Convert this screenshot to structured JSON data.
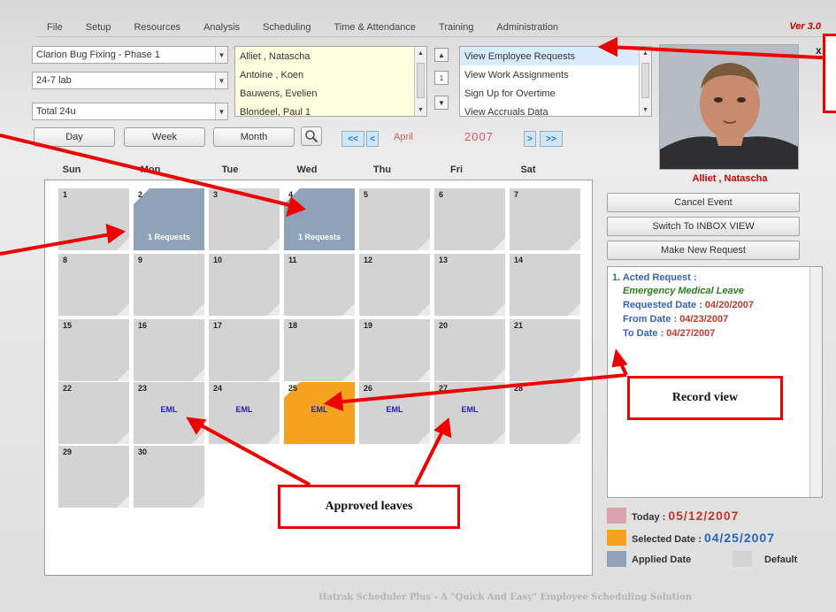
{
  "menu": {
    "items": [
      "File",
      "Setup",
      "Resources",
      "Analysis",
      "Scheduling",
      "Time & Attendance",
      "Training",
      "Administration"
    ],
    "version": "Ver 3.0"
  },
  "filters": {
    "project": "Clarion Bug Fixing - Phase 1",
    "lab": "24-7 lab",
    "group": "Total 24u"
  },
  "employees": [
    "Alliet , Natascha",
    "Antoine , Koen",
    "Bauwens, Evelien",
    "Blondeel, Paul 1"
  ],
  "stepper_value": "1",
  "actions": [
    "View Employee Requests",
    "View Work Assignments",
    "Sign Up for Overtime",
    "View Accruals Data"
  ],
  "view_buttons": {
    "day": "Day",
    "week": "Week",
    "month": "Month"
  },
  "nav": {
    "first": "<<",
    "prev": "<",
    "next": ">",
    "last": ">>"
  },
  "period": {
    "month": "April",
    "year": "2007"
  },
  "employee_name": "Alliet , Natascha",
  "close_label": "x",
  "weekdays": [
    "Sun",
    "Mon",
    "Tue",
    "Wed",
    "Thu",
    "Fri",
    "Sat"
  ],
  "calendar": {
    "weeks": [
      [
        {
          "d": "1"
        },
        {
          "d": "2",
          "type": "applied",
          "label": "1 Requests"
        },
        {
          "d": "3"
        },
        {
          "d": "4",
          "type": "applied",
          "label": "1 Requests"
        },
        {
          "d": "5"
        },
        {
          "d": "6"
        },
        {
          "d": "7"
        }
      ],
      [
        {
          "d": "8"
        },
        {
          "d": "9"
        },
        {
          "d": "10"
        },
        {
          "d": "11"
        },
        {
          "d": "12"
        },
        {
          "d": "13"
        },
        {
          "d": "14"
        }
      ],
      [
        {
          "d": "15"
        },
        {
          "d": "16"
        },
        {
          "d": "17"
        },
        {
          "d": "18"
        },
        {
          "d": "19"
        },
        {
          "d": "20"
        },
        {
          "d": "21"
        }
      ],
      [
        {
          "d": "22"
        },
        {
          "d": "23",
          "eml": "EML"
        },
        {
          "d": "24",
          "eml": "EML"
        },
        {
          "d": "25",
          "type": "selected",
          "eml": "EML"
        },
        {
          "d": "26",
          "eml": "EML"
        },
        {
          "d": "27",
          "eml": "EML"
        },
        {
          "d": "28"
        }
      ],
      [
        {
          "d": "29"
        },
        {
          "d": "30"
        }
      ]
    ]
  },
  "side_buttons": [
    "Cancel Event",
    "Switch To INBOX VIEW",
    "Make New Request"
  ],
  "record": {
    "heading": "1. Acted Request :",
    "type": "Emergency Medical Leave",
    "requested_label": "Requested Date : ",
    "requested_value": "04/20/2007",
    "from_label": "From Date : ",
    "from_value": "04/23/2007",
    "to_label": "To Date : ",
    "to_value": "04/27/2007"
  },
  "legend": {
    "today_label": "Today :",
    "today_value": "05/12/2007",
    "selected_label": "Selected Date :",
    "selected_value": "04/25/2007",
    "applied_label": "Applied Date",
    "default_label": "Default"
  },
  "colors": {
    "today": "#d8a3ad",
    "selected": "#f4a21f",
    "applied": "#8fa3b8",
    "default": "#d3d3d3"
  },
  "footer": "Hatrak Scheduler Plus - A \"Quick And Easy\" Employee Scheduling Solution",
  "callouts": {
    "record_view": "Record view",
    "approved_leaves": "Approved leaves"
  }
}
